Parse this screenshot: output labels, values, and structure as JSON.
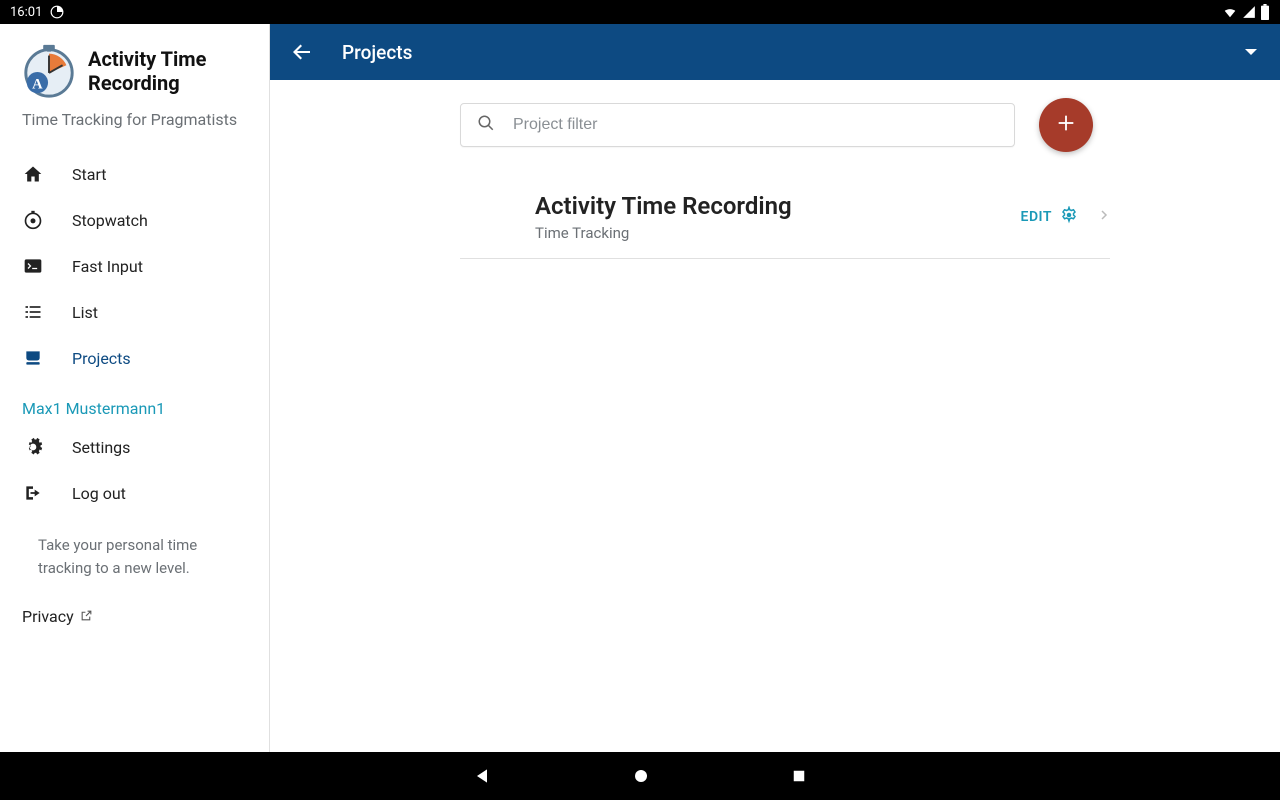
{
  "status": {
    "time": "16:01"
  },
  "app": {
    "title_line1": "Activity Time",
    "title_line2": "Recording",
    "tagline": "Time Tracking for Pragmatists"
  },
  "sidebar": {
    "items": [
      {
        "label": "Start"
      },
      {
        "label": "Stopwatch"
      },
      {
        "label": "Fast Input"
      },
      {
        "label": "List"
      },
      {
        "label": "Projects"
      }
    ],
    "user": "Max1 Mustermann1",
    "settings_label": "Settings",
    "logout_label": "Log out",
    "promo": "Take your personal time tracking to a new level.",
    "privacy_label": "Privacy"
  },
  "page": {
    "title": "Projects",
    "search_placeholder": "Project filter"
  },
  "projects": [
    {
      "name": "Activity Time Recording",
      "subtitle": "Time Tracking",
      "edit_label": "EDIT"
    }
  ]
}
